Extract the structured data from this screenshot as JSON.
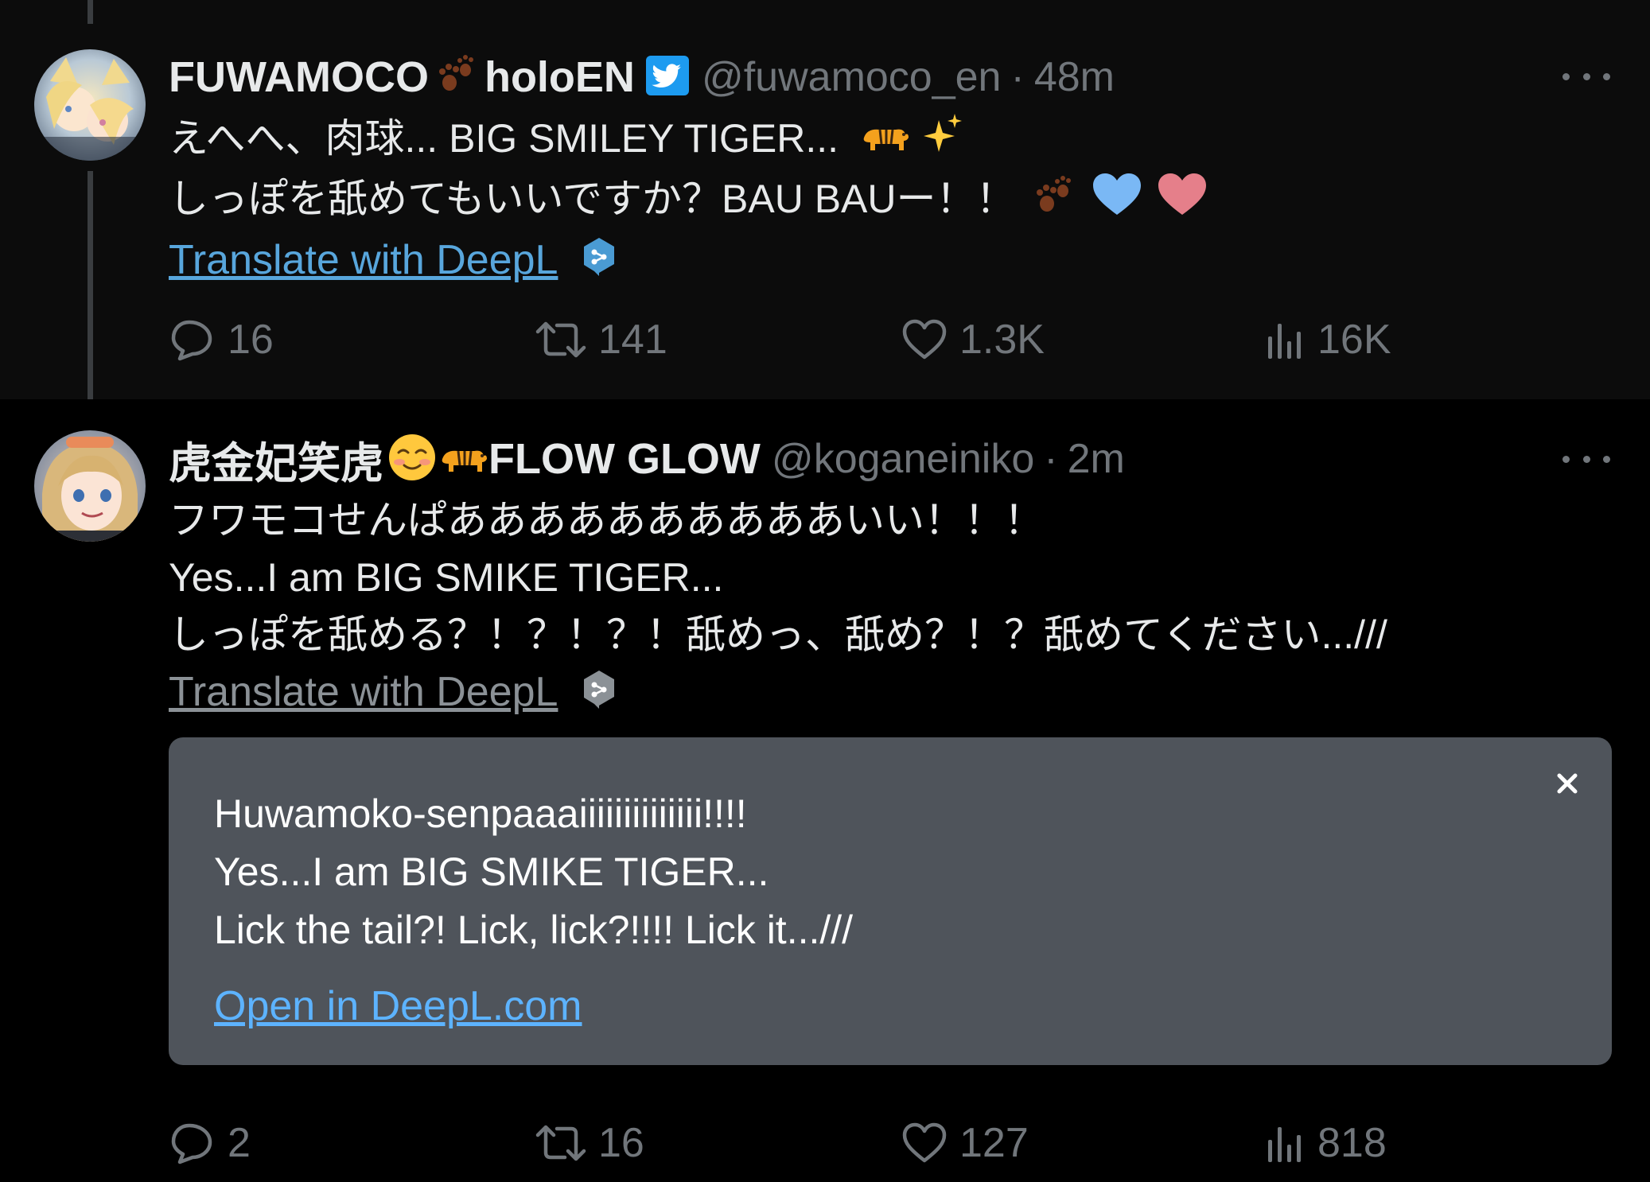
{
  "tweets": [
    {
      "display_name_a": "FUWAMOCO",
      "display_name_b": "holoEN",
      "handle": "@fuwamoco_en",
      "separator": "·",
      "time": "48m",
      "lines": [
        "えへへ、肉球... BIG SMILEY TIGER...",
        "しっぽを舐めてもいいですか？BAU BAUー！！"
      ],
      "translate_label": "Translate with DeepL",
      "stats": {
        "replies": "16",
        "retweets": "141",
        "likes": "1.3K",
        "views": "16K"
      }
    },
    {
      "display_name_a": "虎金妃笑虎",
      "display_name_b": "FLOW GLOW",
      "handle": "@koganeiniko",
      "separator": "·",
      "time": "2m",
      "lines": [
        "フワモコせんぱああああああああああいい！！！",
        "Yes...I am BIG SMIKE TIGER...",
        "しっぽを舐める？！？！？！舐めっ、舐め？！？舐めてください.../// "
      ],
      "translate_label": "Translate with DeepL",
      "translation": {
        "lines": [
          "Huwamoko-senpaaaiiiiiiiiiiiiii!!!!",
          "Yes...I am BIG SMIKE TIGER...",
          "Lick the tail?! Lick, lick?!!!! Lick it.../// "
        ],
        "open_link": "Open in DeepL.com"
      },
      "stats": {
        "replies": "2",
        "retweets": "16",
        "likes": "127",
        "views": "818"
      }
    }
  ],
  "icons": {
    "more": "more-icon",
    "reply": "reply-icon",
    "retweet": "retweet-icon",
    "like": "heart-icon",
    "views": "analytics-icon",
    "deepl": "deepl-icon",
    "verified": "twitter-verified-icon",
    "close": "close-icon"
  },
  "colors": {
    "link_blue": "#58a6dc",
    "link_gray": "#8b9196",
    "muted": "#71767b",
    "translation_bg": "#4f545b"
  }
}
